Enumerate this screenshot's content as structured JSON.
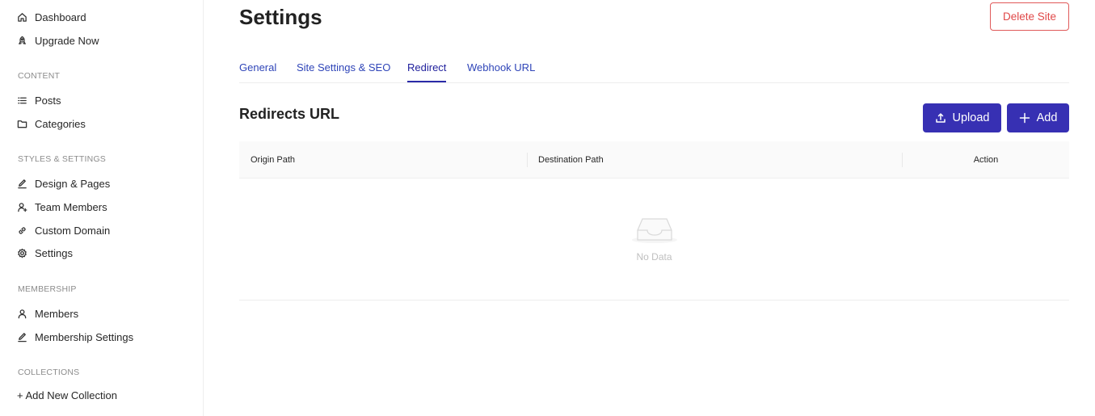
{
  "sidebar": {
    "top_items": [
      {
        "label": "Dashboard",
        "icon": "home-icon"
      },
      {
        "label": "Upgrade Now",
        "icon": "rocket-icon"
      }
    ],
    "sections": [
      {
        "label": "CONTENT",
        "items": [
          {
            "label": "Posts",
            "icon": "list-icon"
          },
          {
            "label": "Categories",
            "icon": "folder-icon"
          }
        ]
      },
      {
        "label": "STYLES & SETTINGS",
        "items": [
          {
            "label": "Design & Pages",
            "icon": "pencil-icon"
          },
          {
            "label": "Team Members",
            "icon": "user-plus-icon"
          },
          {
            "label": "Custom Domain",
            "icon": "link-icon"
          },
          {
            "label": "Settings",
            "icon": "gear-icon"
          }
        ]
      },
      {
        "label": "MEMBERSHIP",
        "items": [
          {
            "label": "Members",
            "icon": "user-icon"
          },
          {
            "label": "Membership Settings",
            "icon": "pencil-icon"
          }
        ]
      },
      {
        "label": "COLLECTIONS",
        "items": []
      }
    ],
    "add_collection": "+ Add New Collection"
  },
  "header": {
    "title": "Settings",
    "delete_label": "Delete Site"
  },
  "tabs": [
    {
      "label": "General",
      "active": false
    },
    {
      "label": "Site Settings & SEO",
      "active": false
    },
    {
      "label": "Redirect",
      "active": true
    },
    {
      "label": "Webhook URL",
      "active": false
    }
  ],
  "redirects": {
    "title": "Redirects URL",
    "upload_label": "Upload",
    "add_label": "Add",
    "columns": [
      "Origin Path",
      "Destination Path",
      "Action"
    ],
    "rows": [],
    "empty_text": "No Data"
  },
  "colors": {
    "primary": "#3730b3",
    "danger": "#e04848",
    "tab_link": "#2f45b8"
  }
}
